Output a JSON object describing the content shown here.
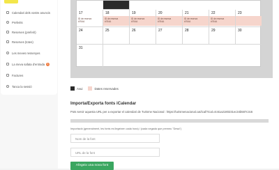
{
  "sidebar": {
    "items": [
      {
        "label": "Calendari dels vostre anuncis"
      },
      {
        "label": "Preferits"
      },
      {
        "label": "Reserves (preferit)"
      },
      {
        "label": "Reserves (totes)"
      },
      {
        "label": "Les meves ressenyes"
      },
      {
        "label": "La meva safata d'entrada",
        "badge": "1"
      },
      {
        "label": "Factures"
      },
      {
        "label": "Tanca la sessió"
      }
    ]
  },
  "calendar": {
    "rows": [
      [
        "17",
        "18",
        "19",
        "20",
        "21",
        "22",
        "23"
      ],
      [
        "24",
        "25",
        "26",
        "27",
        "28",
        "29",
        "30"
      ],
      [
        "31",
        "",
        "",
        "",
        "",
        "",
        ""
      ]
    ],
    "reservation_line1": "ID de reserva",
    "reservation_line2": "#764A",
    "colors": {
      "reserved": "#f6d5cc",
      "free": "#ffffff",
      "past": "#2b2b2b"
    }
  },
  "legend": {
    "free_label": "Avui",
    "reserved_label": "Dates reservades"
  },
  "ical": {
    "title": "Importa/Exporta fonts iCalendar",
    "export_text": "Pots servir aquesta URL per a exportar el calendari de Turisme Nacional : https://turismenacional.cat/ical/?ical=4c61a2180231ec34b587c3c6",
    "import_text": "Importació (generalment, les fonts es llegeixen cada hora) / (cada vegada que premeu \"Desa\")",
    "name_placeholder": "Nom de la font",
    "url_placeholder": "URL de la font",
    "add_button": "Afegeix una nova font"
  }
}
